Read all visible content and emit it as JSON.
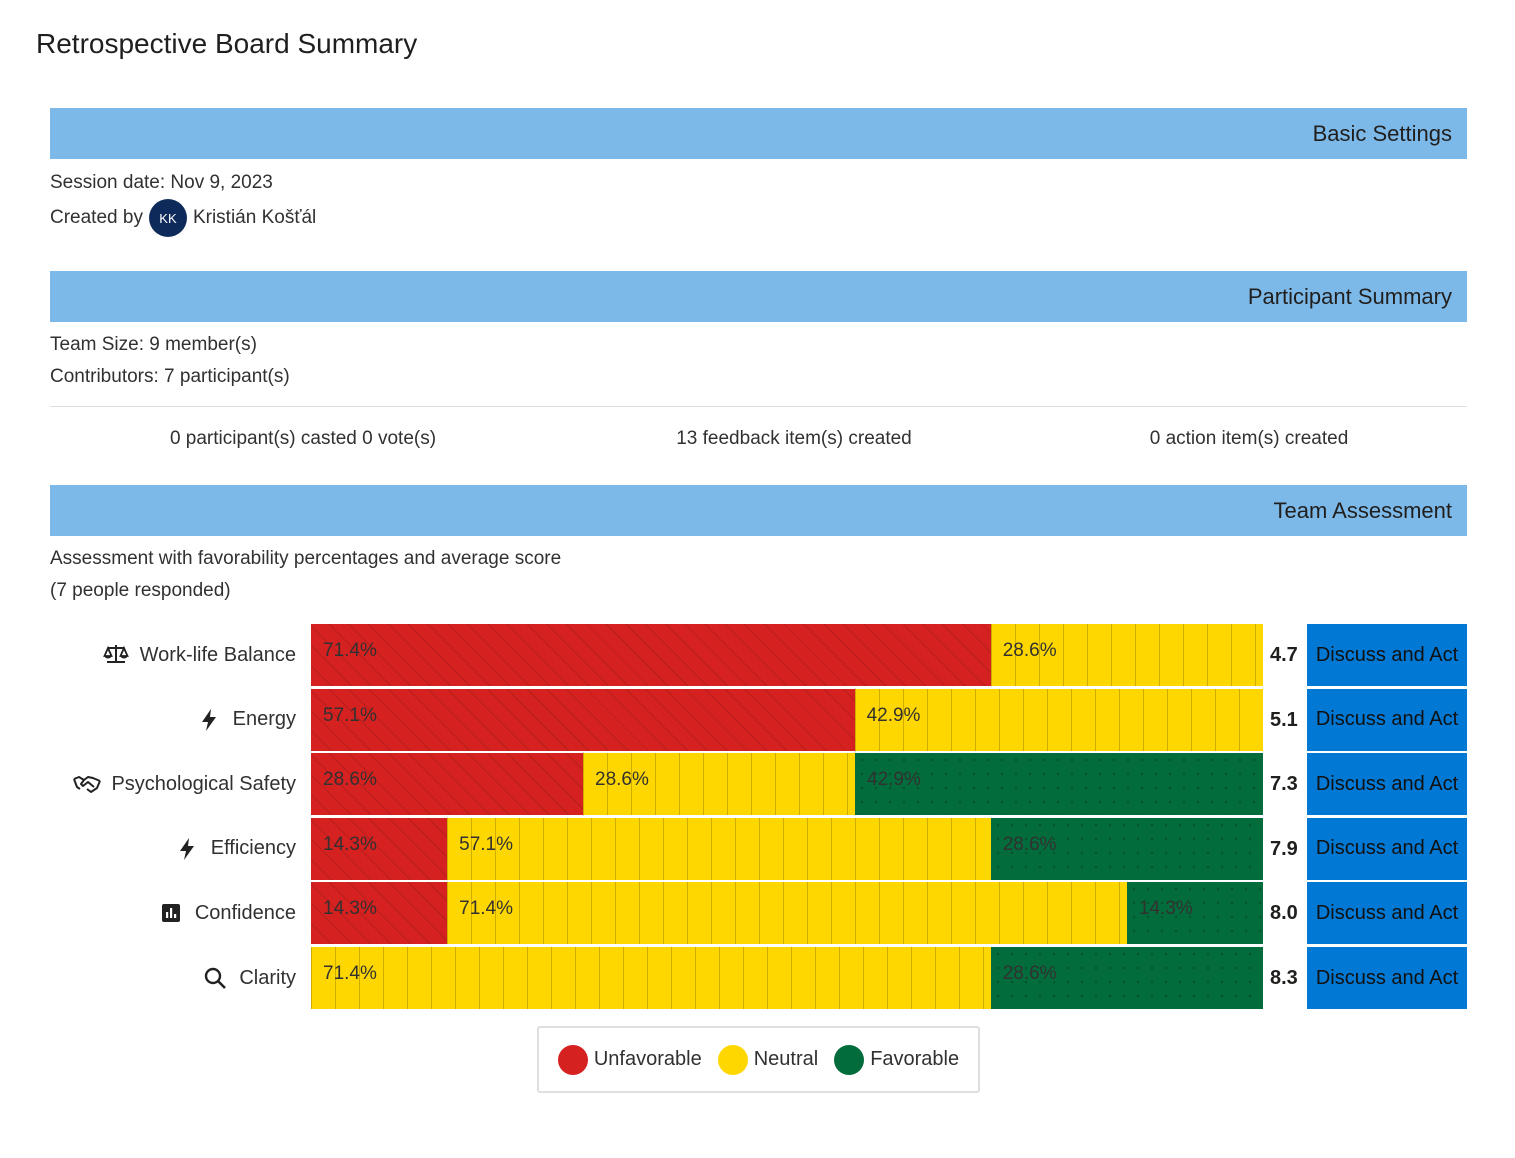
{
  "title": "Retrospective Board Summary",
  "sections": {
    "basic": "Basic Settings",
    "participants": "Participant Summary",
    "assessment": "Team Assessment"
  },
  "basic": {
    "session_date": "Session date: Nov 9, 2023",
    "created_by_label": "Created by",
    "creator_initials": "KK",
    "creator_name": "Kristián Košťál"
  },
  "participants": {
    "team_size": "Team Size: 9 member(s)",
    "contributors": "Contributors: 7 participant(s)",
    "votes": "0 participant(s) casted 0 vote(s)",
    "feedback": "13 feedback item(s) created",
    "actions": "0 action item(s) created"
  },
  "assessment": {
    "description": "Assessment with favorability percentages and average score",
    "responded": "(7 people responded)",
    "discuss_label": "Discuss and Act"
  },
  "colors": {
    "unfavorable": "#d62121",
    "neutral": "#ffd700",
    "favorable": "#036c3c",
    "header": "#7db9e8",
    "button": "#0078d4"
  },
  "chart_data": {
    "type": "bar",
    "stacked": true,
    "orientation": "horizontal",
    "categories": [
      "Work-life Balance",
      "Energy",
      "Psychological Safety",
      "Efficiency",
      "Confidence",
      "Clarity"
    ],
    "icons": [
      "scale-icon",
      "lightning-icon",
      "handshake-icon",
      "lightning-icon",
      "chart-box-icon",
      "search-icon"
    ],
    "series": [
      {
        "name": "Unfavorable",
        "values": [
          71.4,
          57.1,
          28.6,
          14.3,
          14.3,
          0
        ]
      },
      {
        "name": "Neutral",
        "values": [
          28.6,
          42.9,
          28.6,
          57.1,
          71.4,
          71.4
        ]
      },
      {
        "name": "Favorable",
        "values": [
          0,
          0,
          42.9,
          28.6,
          14.3,
          28.6
        ]
      }
    ],
    "scores": [
      "4.7",
      "5.1",
      "7.3",
      "7.9",
      "8.0",
      "8.3"
    ],
    "legend": [
      "Unfavorable",
      "Neutral",
      "Favorable"
    ],
    "legend_placement": "bottom"
  }
}
